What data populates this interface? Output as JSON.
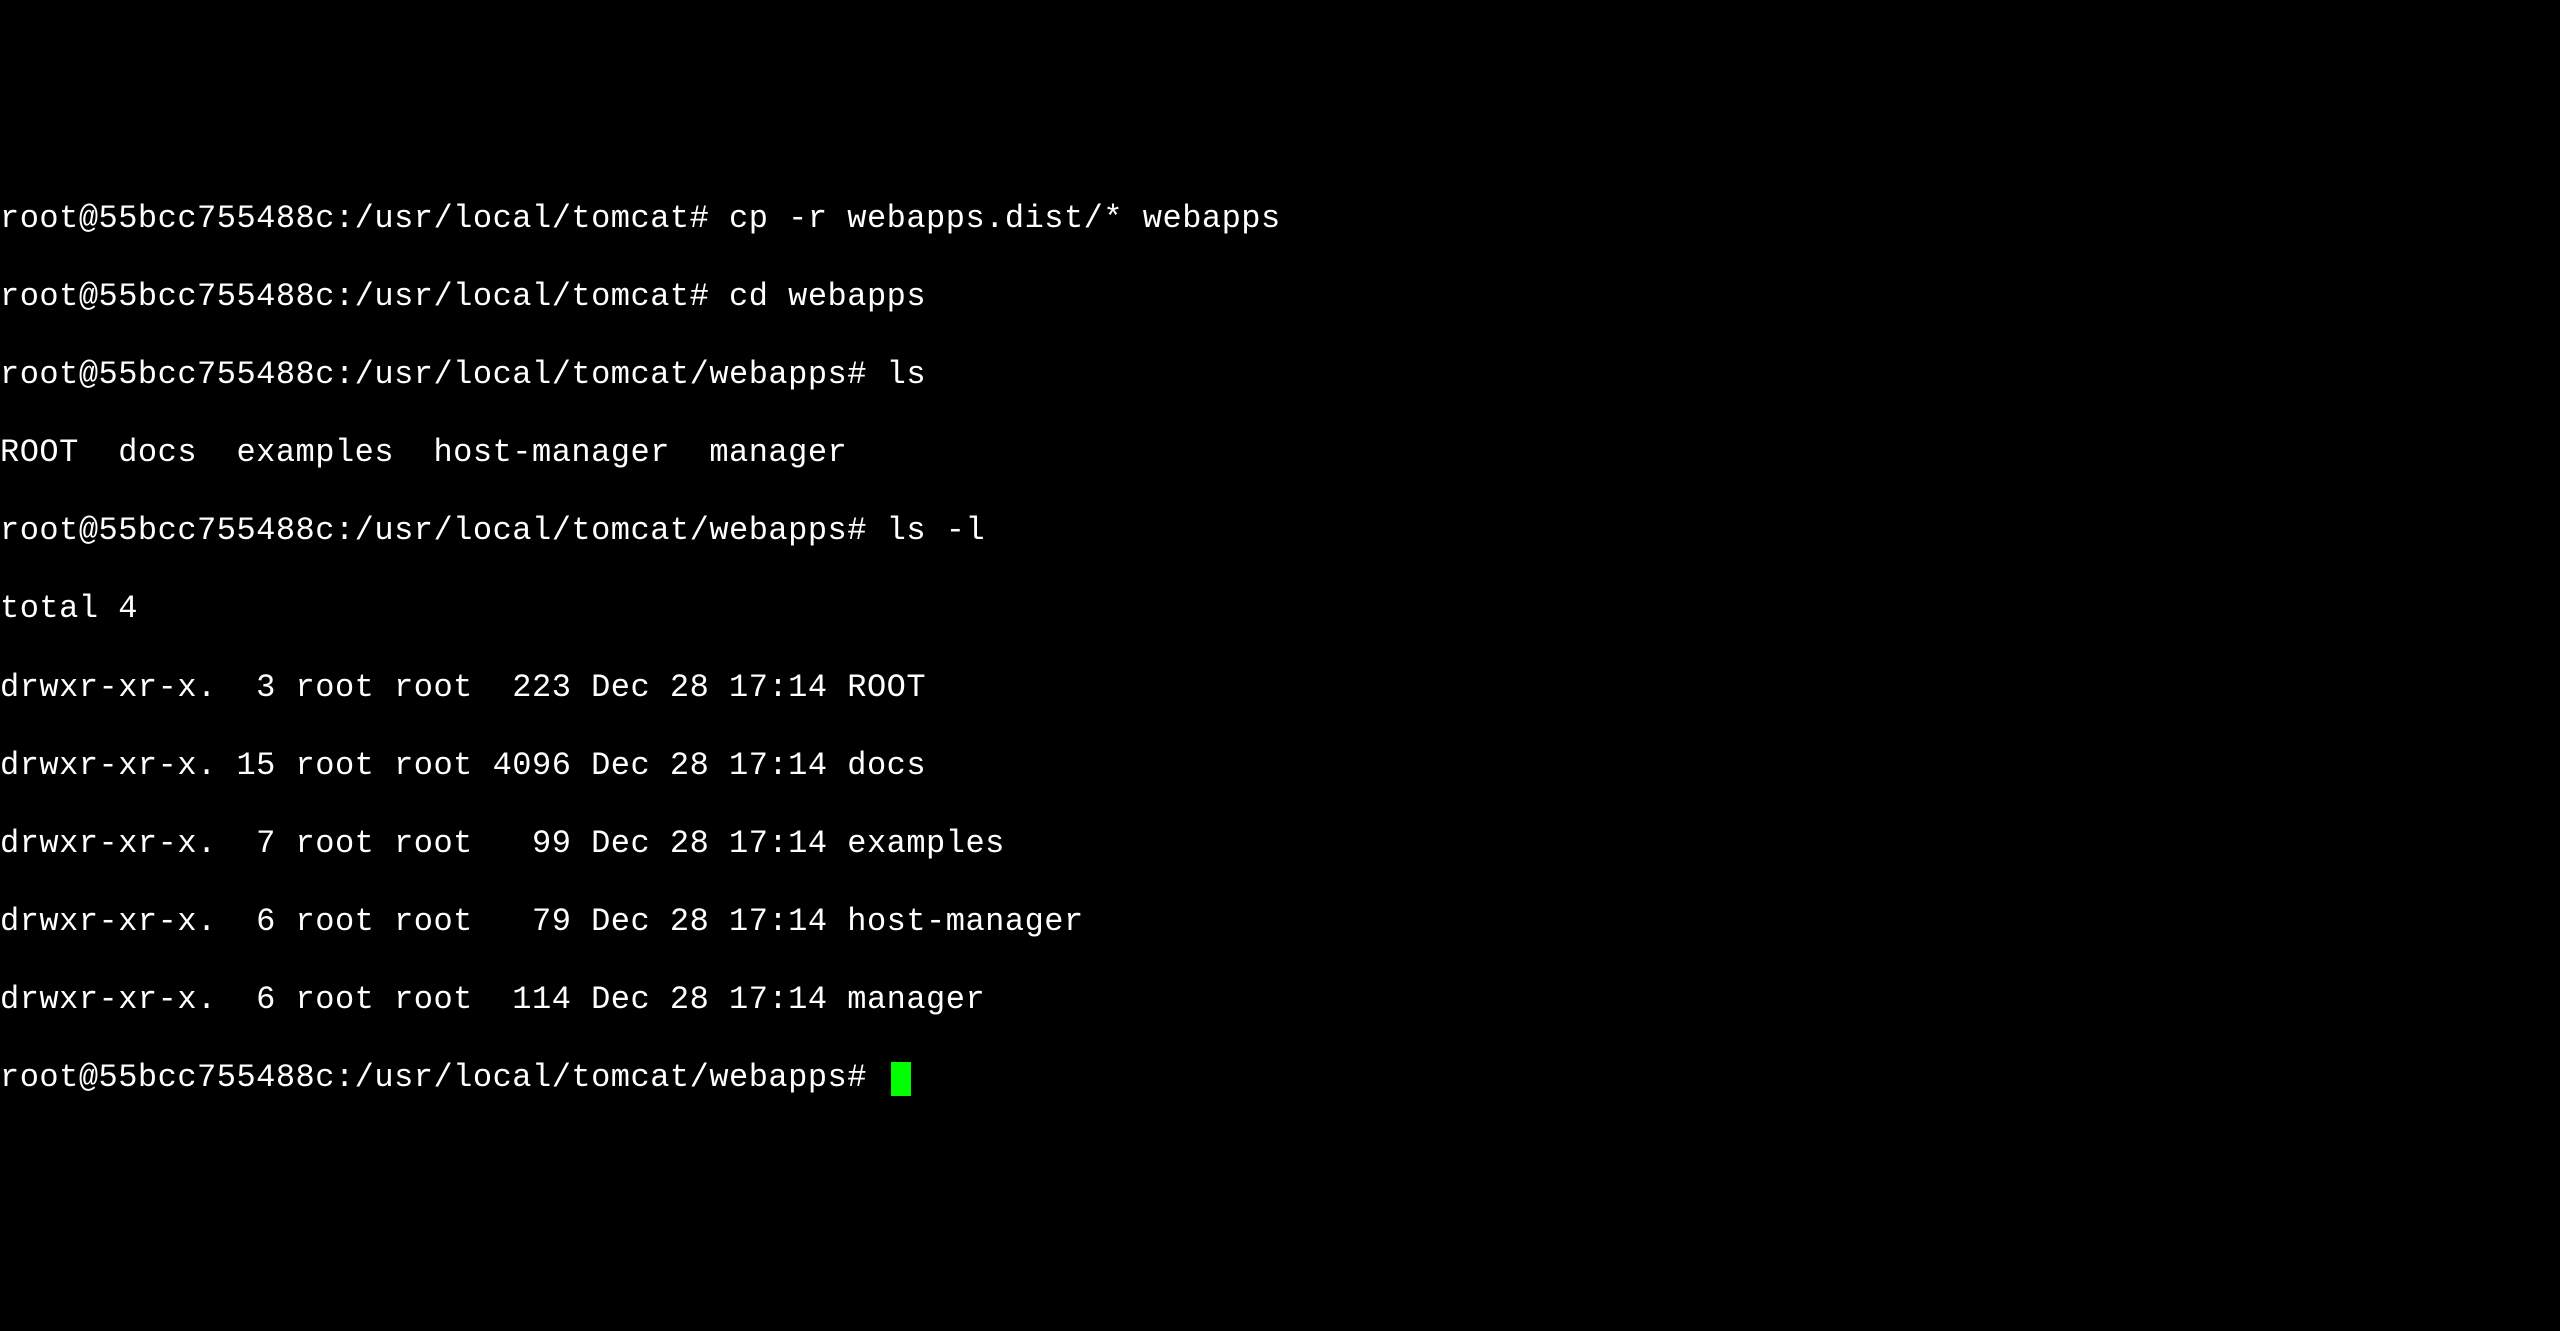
{
  "terminal": {
    "sessions": [
      {
        "prompt": "root@55bcc755488c:/usr/local/tomcat#",
        "command": "cp -r webapps.dist/* webapps"
      },
      {
        "prompt": "root@55bcc755488c:/usr/local/tomcat#",
        "command": "cd webapps"
      },
      {
        "prompt": "root@55bcc755488c:/usr/local/tomcat/webapps#",
        "command": "ls"
      }
    ],
    "ls_output": "ROOT  docs  examples  host-manager  manager",
    "ls_l_prompt": "root@55bcc755488c:/usr/local/tomcat/webapps#",
    "ls_l_command": "ls -l",
    "total": "total 4",
    "listing": [
      {
        "perms": "drwxr-xr-x.",
        "links": " 3",
        "owner": "root",
        "group": "root",
        "size": " 223",
        "date": "Dec 28 17:14",
        "name": "ROOT"
      },
      {
        "perms": "drwxr-xr-x.",
        "links": "15",
        "owner": "root",
        "group": "root",
        "size": "4096",
        "date": "Dec 28 17:14",
        "name": "docs"
      },
      {
        "perms": "drwxr-xr-x.",
        "links": " 7",
        "owner": "root",
        "group": "root",
        "size": "  99",
        "date": "Dec 28 17:14",
        "name": "examples"
      },
      {
        "perms": "drwxr-xr-x.",
        "links": " 6",
        "owner": "root",
        "group": "root",
        "size": "  79",
        "date": "Dec 28 17:14",
        "name": "host-manager"
      },
      {
        "perms": "drwxr-xr-x.",
        "links": " 6",
        "owner": "root",
        "group": "root",
        "size": " 114",
        "date": "Dec 28 17:14",
        "name": "manager"
      }
    ],
    "final_prompt": "root@55bcc755488c:/usr/local/tomcat/webapps#"
  }
}
